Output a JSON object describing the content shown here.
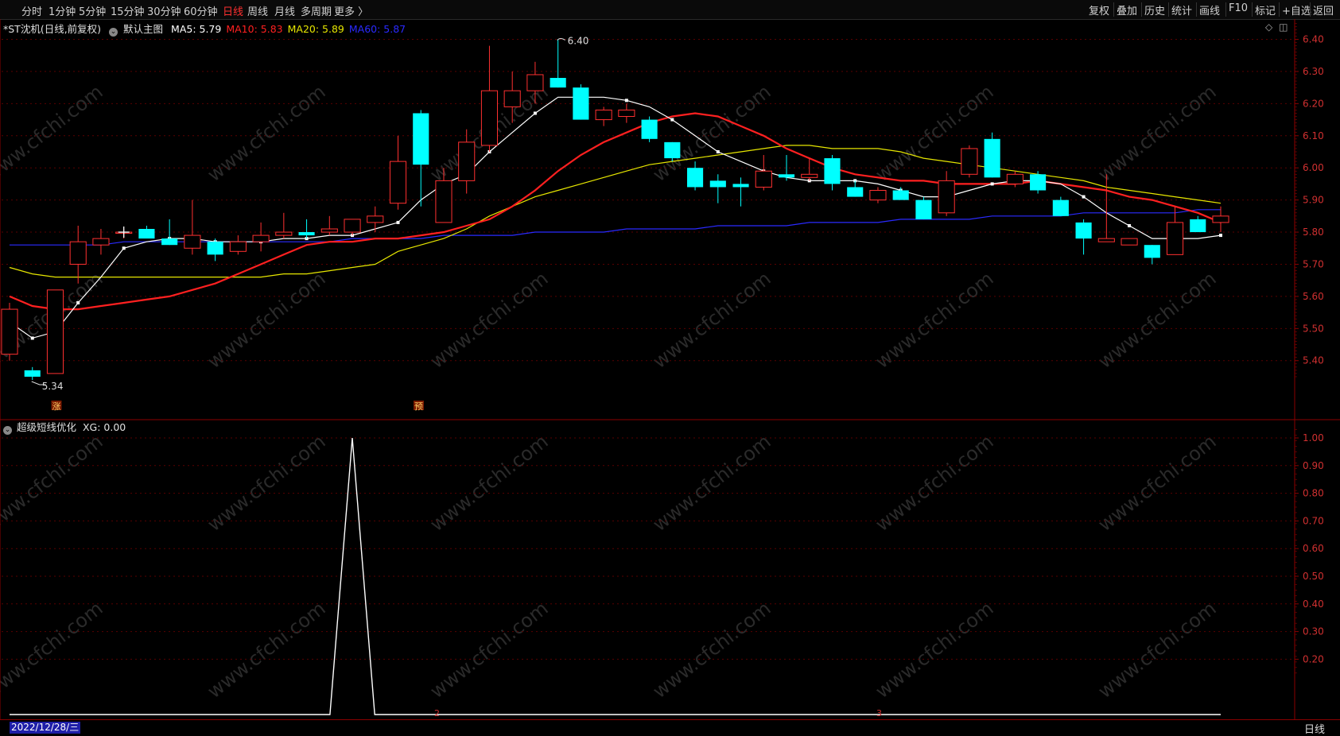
{
  "toolbar": {
    "periods": [
      "分时",
      "1分钟",
      "5分钟",
      "15分钟",
      "30分钟",
      "60分钟",
      "日线",
      "周线",
      "月线",
      "多周期",
      "更多 〉"
    ],
    "active_period": "日线",
    "right_buttons": [
      "复权",
      "叠加",
      "历史",
      "统计",
      "画线",
      "F10",
      "标记",
      "+自选",
      "返回"
    ]
  },
  "main_panel": {
    "stock_title": "*ST沈机(日线,前复权)",
    "template": "默认主图",
    "ma": [
      {
        "label": "MA5: 5.79",
        "color": "#ffffff"
      },
      {
        "label": "MA10: 5.83",
        "color": "#ff2020"
      },
      {
        "label": "MA20: 5.89",
        "color": "#e6e600"
      },
      {
        "label": "MA60: 5.87",
        "color": "#2a2aff"
      }
    ],
    "high_label": "6.40",
    "low_label": "5.34",
    "badges": [
      "涨",
      "预"
    ],
    "price_axis": [
      "6.40",
      "6.30",
      "6.20",
      "6.10",
      "6.00",
      "5.90",
      "5.80",
      "5.70",
      "5.60",
      "5.50",
      "5.40"
    ]
  },
  "indicator_panel": {
    "name": "超级短线优化",
    "value_label": "XG: 0.00",
    "axis": [
      "1.00",
      "0.90",
      "0.80",
      "0.70",
      "0.60",
      "0.50",
      "0.40",
      "0.30",
      "0.20"
    ]
  },
  "status": {
    "date": "2022/12/28/三",
    "month_marks": [
      "2",
      "3"
    ],
    "period": "日线"
  },
  "watermark": "www.cfchi.com",
  "chart_data": {
    "type": "candlestick",
    "candles": [
      {
        "o": 5.42,
        "h": 5.58,
        "l": 5.4,
        "c": 5.56
      },
      {
        "o": 5.37,
        "h": 5.38,
        "l": 5.34,
        "c": 5.35
      },
      {
        "o": 5.36,
        "h": 5.62,
        "l": 5.36,
        "c": 5.62
      },
      {
        "o": 5.7,
        "h": 5.82,
        "l": 5.64,
        "c": 5.77
      },
      {
        "o": 5.76,
        "h": 5.81,
        "l": 5.73,
        "c": 5.78
      },
      {
        "o": 5.8,
        "h": 5.81,
        "l": 5.78,
        "c": 5.8
      },
      {
        "o": 5.81,
        "h": 5.82,
        "l": 5.79,
        "c": 5.78
      },
      {
        "o": 5.78,
        "h": 5.84,
        "l": 5.76,
        "c": 5.76
      },
      {
        "o": 5.75,
        "h": 5.9,
        "l": 5.73,
        "c": 5.79
      },
      {
        "o": 5.77,
        "h": 5.78,
        "l": 5.71,
        "c": 5.73
      },
      {
        "o": 5.74,
        "h": 5.79,
        "l": 5.73,
        "c": 5.77
      },
      {
        "o": 5.77,
        "h": 5.83,
        "l": 5.74,
        "c": 5.79
      },
      {
        "o": 5.79,
        "h": 5.86,
        "l": 5.78,
        "c": 5.8
      },
      {
        "o": 5.8,
        "h": 5.84,
        "l": 5.78,
        "c": 5.79
      },
      {
        "o": 5.8,
        "h": 5.85,
        "l": 5.79,
        "c": 5.81
      },
      {
        "o": 5.8,
        "h": 5.84,
        "l": 5.79,
        "c": 5.84
      },
      {
        "o": 5.83,
        "h": 5.88,
        "l": 5.8,
        "c": 5.85
      },
      {
        "o": 5.89,
        "h": 6.1,
        "l": 5.87,
        "c": 6.02
      },
      {
        "o": 6.17,
        "h": 6.18,
        "l": 5.88,
        "c": 6.01
      },
      {
        "o": 5.83,
        "h": 6.0,
        "l": 5.83,
        "c": 5.96
      },
      {
        "o": 5.96,
        "h": 6.12,
        "l": 5.92,
        "c": 6.08
      },
      {
        "o": 6.07,
        "h": 6.38,
        "l": 6.05,
        "c": 6.24
      },
      {
        "o": 6.19,
        "h": 6.3,
        "l": 6.14,
        "c": 6.24
      },
      {
        "o": 6.24,
        "h": 6.33,
        "l": 6.2,
        "c": 6.29
      },
      {
        "o": 6.28,
        "h": 6.4,
        "l": 6.25,
        "c": 6.25
      },
      {
        "o": 6.25,
        "h": 6.26,
        "l": 6.15,
        "c": 6.15
      },
      {
        "o": 6.15,
        "h": 6.19,
        "l": 6.13,
        "c": 6.18
      },
      {
        "o": 6.16,
        "h": 6.2,
        "l": 6.14,
        "c": 6.18
      },
      {
        "o": 6.15,
        "h": 6.16,
        "l": 6.08,
        "c": 6.09
      },
      {
        "o": 6.08,
        "h": 6.08,
        "l": 6.02,
        "c": 6.03
      },
      {
        "o": 6.0,
        "h": 6.02,
        "l": 5.93,
        "c": 5.94
      },
      {
        "o": 5.96,
        "h": 5.98,
        "l": 5.89,
        "c": 5.94
      },
      {
        "o": 5.95,
        "h": 5.97,
        "l": 5.88,
        "c": 5.94
      },
      {
        "o": 5.94,
        "h": 6.04,
        "l": 5.93,
        "c": 5.99
      },
      {
        "o": 5.98,
        "h": 6.04,
        "l": 5.96,
        "c": 5.97
      },
      {
        "o": 5.97,
        "h": 6.03,
        "l": 5.96,
        "c": 5.98
      },
      {
        "o": 6.03,
        "h": 6.04,
        "l": 5.93,
        "c": 5.95
      },
      {
        "o": 5.94,
        "h": 5.96,
        "l": 5.91,
        "c": 5.91
      },
      {
        "o": 5.9,
        "h": 5.94,
        "l": 5.89,
        "c": 5.93
      },
      {
        "o": 5.93,
        "h": 5.94,
        "l": 5.91,
        "c": 5.9
      },
      {
        "o": 5.9,
        "h": 5.91,
        "l": 5.84,
        "c": 5.84
      },
      {
        "o": 5.86,
        "h": 5.99,
        "l": 5.85,
        "c": 5.96
      },
      {
        "o": 5.98,
        "h": 6.07,
        "l": 5.97,
        "c": 6.06
      },
      {
        "o": 6.09,
        "h": 6.11,
        "l": 5.97,
        "c": 5.97
      },
      {
        "o": 5.95,
        "h": 5.99,
        "l": 5.94,
        "c": 5.98
      },
      {
        "o": 5.98,
        "h": 5.99,
        "l": 5.92,
        "c": 5.93
      },
      {
        "o": 5.9,
        "h": 5.91,
        "l": 5.85,
        "c": 5.85
      },
      {
        "o": 5.83,
        "h": 5.84,
        "l": 5.73,
        "c": 5.78
      },
      {
        "o": 5.77,
        "h": 5.98,
        "l": 5.77,
        "c": 5.78
      },
      {
        "o": 5.76,
        "h": 5.78,
        "l": 5.76,
        "c": 5.78
      },
      {
        "o": 5.76,
        "h": 5.76,
        "l": 5.7,
        "c": 5.72
      },
      {
        "o": 5.73,
        "h": 5.88,
        "l": 5.73,
        "c": 5.83
      },
      {
        "o": 5.84,
        "h": 5.85,
        "l": 5.8,
        "c": 5.8
      },
      {
        "o": 5.83,
        "h": 5.88,
        "l": 5.8,
        "c": 5.85
      }
    ],
    "ma5": [
      5.52,
      5.47,
      5.49,
      5.58,
      5.66,
      5.75,
      5.77,
      5.78,
      5.78,
      5.77,
      5.77,
      5.77,
      5.78,
      5.78,
      5.79,
      5.79,
      5.81,
      5.83,
      5.9,
      5.95,
      5.98,
      6.05,
      6.11,
      6.17,
      6.22,
      6.22,
      6.22,
      6.21,
      6.19,
      6.15,
      6.1,
      6.05,
      6.02,
      5.99,
      5.97,
      5.96,
      5.96,
      5.96,
      5.95,
      5.93,
      5.91,
      5.91,
      5.93,
      5.95,
      5.96,
      5.96,
      5.95,
      5.91,
      5.86,
      5.82,
      5.78,
      5.78,
      5.78,
      5.79
    ],
    "ma10": [
      5.6,
      5.57,
      5.56,
      5.56,
      5.57,
      5.58,
      5.59,
      5.6,
      5.62,
      5.64,
      5.67,
      5.7,
      5.73,
      5.76,
      5.77,
      5.77,
      5.78,
      5.78,
      5.79,
      5.8,
      5.82,
      5.84,
      5.88,
      5.93,
      5.99,
      6.04,
      6.08,
      6.11,
      6.14,
      6.16,
      6.17,
      6.16,
      6.13,
      6.1,
      6.06,
      6.03,
      6.0,
      5.98,
      5.97,
      5.96,
      5.96,
      5.95,
      5.95,
      5.95,
      5.95,
      5.96,
      5.95,
      5.94,
      5.93,
      5.91,
      5.9,
      5.88,
      5.86,
      5.83
    ],
    "ma20": [
      5.69,
      5.67,
      5.66,
      5.66,
      5.66,
      5.66,
      5.66,
      5.66,
      5.66,
      5.66,
      5.66,
      5.66,
      5.67,
      5.67,
      5.68,
      5.69,
      5.7,
      5.74,
      5.76,
      5.78,
      5.81,
      5.85,
      5.88,
      5.91,
      5.93,
      5.95,
      5.97,
      5.99,
      6.01,
      6.02,
      6.03,
      6.04,
      6.05,
      6.06,
      6.07,
      6.07,
      6.06,
      6.06,
      6.06,
      6.05,
      6.03,
      6.02,
      6.01,
      6.0,
      5.99,
      5.98,
      5.97,
      5.96,
      5.94,
      5.93,
      5.92,
      5.91,
      5.9,
      5.89
    ],
    "ma60": [
      5.76,
      5.76,
      5.76,
      5.76,
      5.76,
      5.77,
      5.77,
      5.77,
      5.77,
      5.77,
      5.77,
      5.77,
      5.77,
      5.77,
      5.77,
      5.78,
      5.78,
      5.78,
      5.78,
      5.79,
      5.79,
      5.79,
      5.79,
      5.8,
      5.8,
      5.8,
      5.8,
      5.81,
      5.81,
      5.81,
      5.81,
      5.82,
      5.82,
      5.82,
      5.82,
      5.83,
      5.83,
      5.83,
      5.83,
      5.84,
      5.84,
      5.84,
      5.84,
      5.85,
      5.85,
      5.85,
      5.85,
      5.86,
      5.86,
      5.86,
      5.86,
      5.86,
      5.87,
      5.87
    ],
    "xg": [
      0,
      0,
      0,
      0,
      0,
      0,
      0,
      0,
      0,
      0,
      0,
      0,
      0,
      0,
      0,
      1,
      0,
      0,
      0,
      0,
      0,
      0,
      0,
      0,
      0,
      0,
      0,
      0,
      0,
      0,
      0,
      0,
      0,
      0,
      0,
      0,
      0,
      0,
      0,
      0,
      0,
      0,
      0,
      0,
      0,
      0,
      0,
      0,
      0,
      0,
      0,
      0,
      0,
      0
    ],
    "price_range": [
      5.34,
      6.45
    ],
    "xg_range": [
      0,
      1.05
    ],
    "colors": {
      "up": "#ff3030",
      "down": "#00ffff",
      "ma5": "#ffffff",
      "ma10": "#ff2020",
      "ma20": "#e6e600",
      "ma60": "#2a2aff",
      "xg": "#ffffff"
    }
  }
}
